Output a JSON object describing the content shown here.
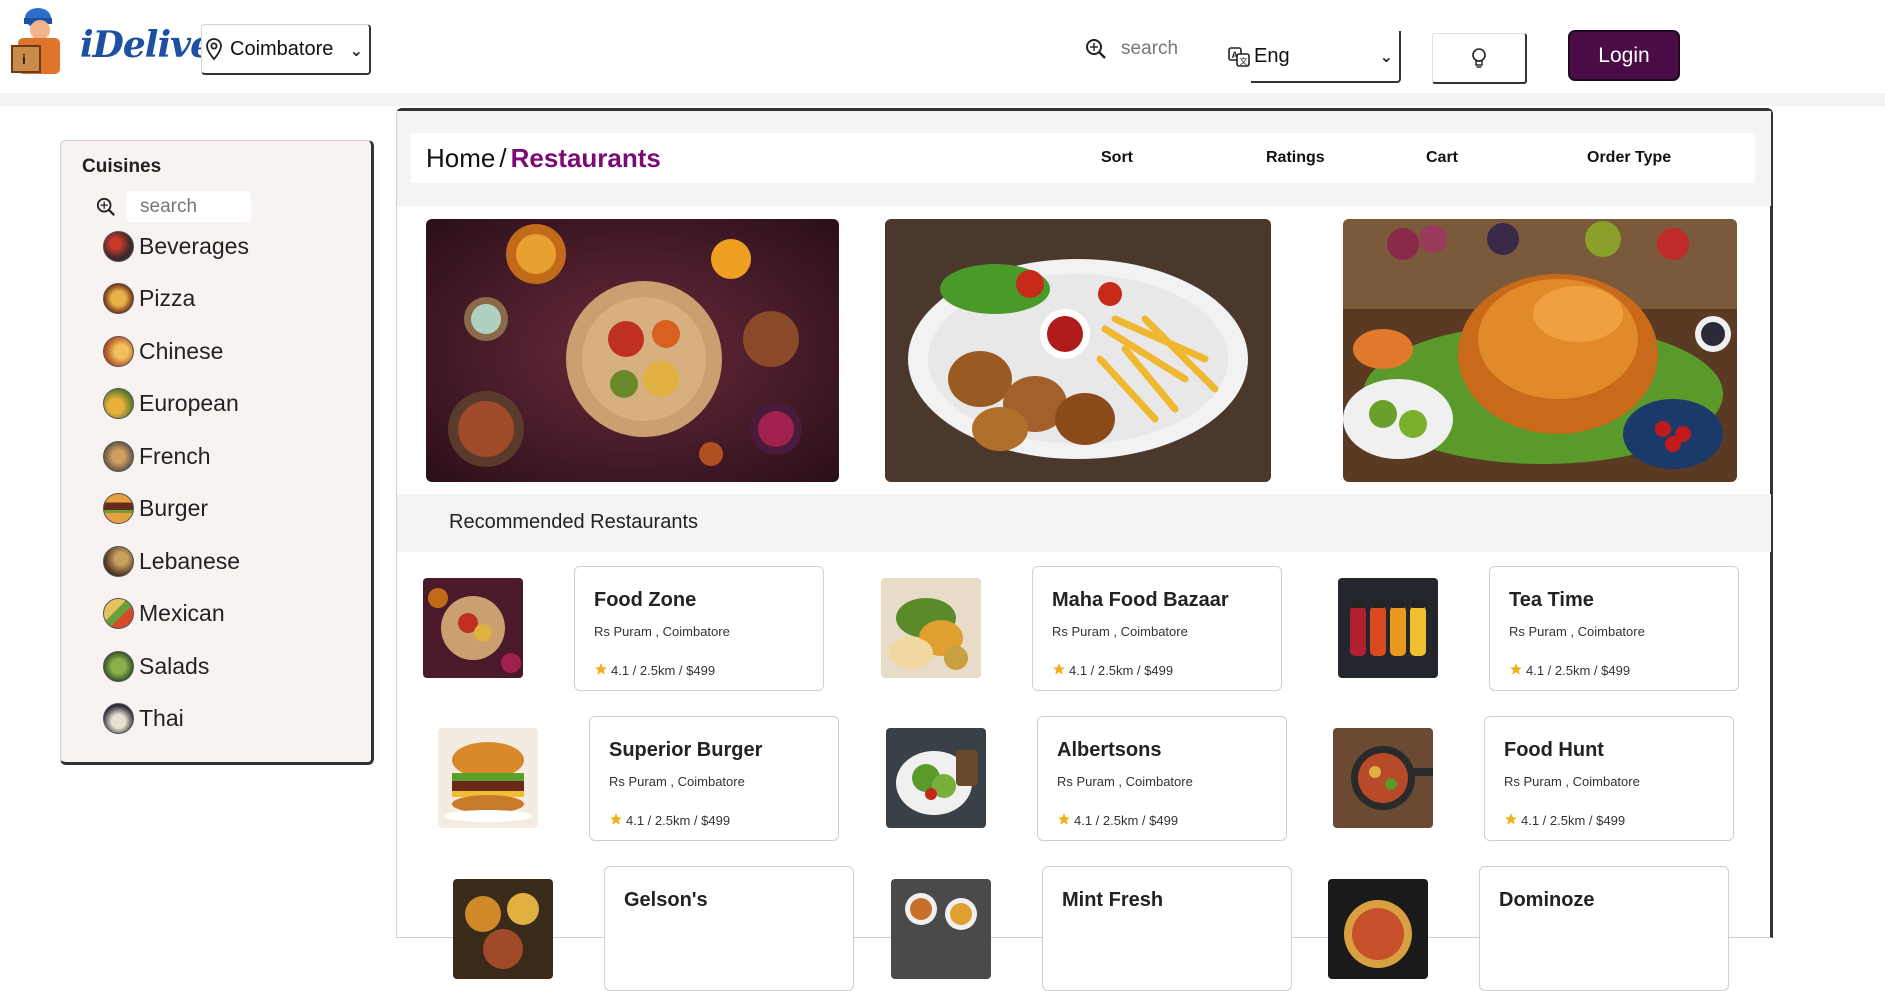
{
  "brand": {
    "name": "iDeliver"
  },
  "location": {
    "selected": "Coimbatore"
  },
  "top_search": {
    "label": "search"
  },
  "language": {
    "selected": "Eng"
  },
  "login": {
    "label": "Login"
  },
  "sidebar": {
    "title": "Cuisines",
    "search_placeholder": "search",
    "items": [
      {
        "label": "Beverages",
        "color": "#3b2a2a"
      },
      {
        "label": "Pizza",
        "color": "#b87a2a"
      },
      {
        "label": "Chinese",
        "color": "#c9862f"
      },
      {
        "label": "European",
        "color": "#8a9a3a"
      },
      {
        "label": "French",
        "color": "#9a6a3a"
      },
      {
        "label": "Burger",
        "color": "#b5642a"
      },
      {
        "label": "Lebanese",
        "color": "#6a4a2a"
      },
      {
        "label": "Mexican",
        "color": "#b88a3a"
      },
      {
        "label": "Salads",
        "color": "#5a7a3a"
      },
      {
        "label": "Thai",
        "color": "#3a3a4a"
      }
    ]
  },
  "breadcrumb": {
    "home": "Home",
    "separator": "/",
    "current": "Restaurants"
  },
  "toolbar": {
    "sort": "Sort",
    "ratings": "Ratings",
    "cart": "Cart",
    "order_type": "Order Type"
  },
  "recommended": {
    "title": "Recommended Restaurants",
    "restaurants": [
      {
        "name": "Food Zone",
        "address": "Rs Puram , Coimbatore",
        "meta": "4.1 / 2.5km / $499"
      },
      {
        "name": "Maha Food Bazaar",
        "address": "Rs Puram , Coimbatore",
        "meta": "4.1 / 2.5km / $499"
      },
      {
        "name": "Tea Time",
        "address": "Rs Puram , Coimbatore",
        "meta": "4.1 / 2.5km / $499"
      },
      {
        "name": "Superior Burger",
        "address": "Rs Puram , Coimbatore",
        "meta": "4.1 / 2.5km / $499"
      },
      {
        "name": "Albertsons",
        "address": "Rs Puram , Coimbatore",
        "meta": "4.1 / 2.5km / $499"
      },
      {
        "name": "Food Hunt",
        "address": "Rs Puram , Coimbatore",
        "meta": "4.1 / 2.5km / $499"
      },
      {
        "name": "Gelson's",
        "address": "",
        "meta": ""
      },
      {
        "name": "Mint Fresh",
        "address": "",
        "meta": ""
      },
      {
        "name": "Dominoze",
        "address": "",
        "meta": ""
      }
    ]
  },
  "colors": {
    "accent": "#7b0a76",
    "login_bg": "#4a0b47",
    "star": "#f2b01e"
  }
}
